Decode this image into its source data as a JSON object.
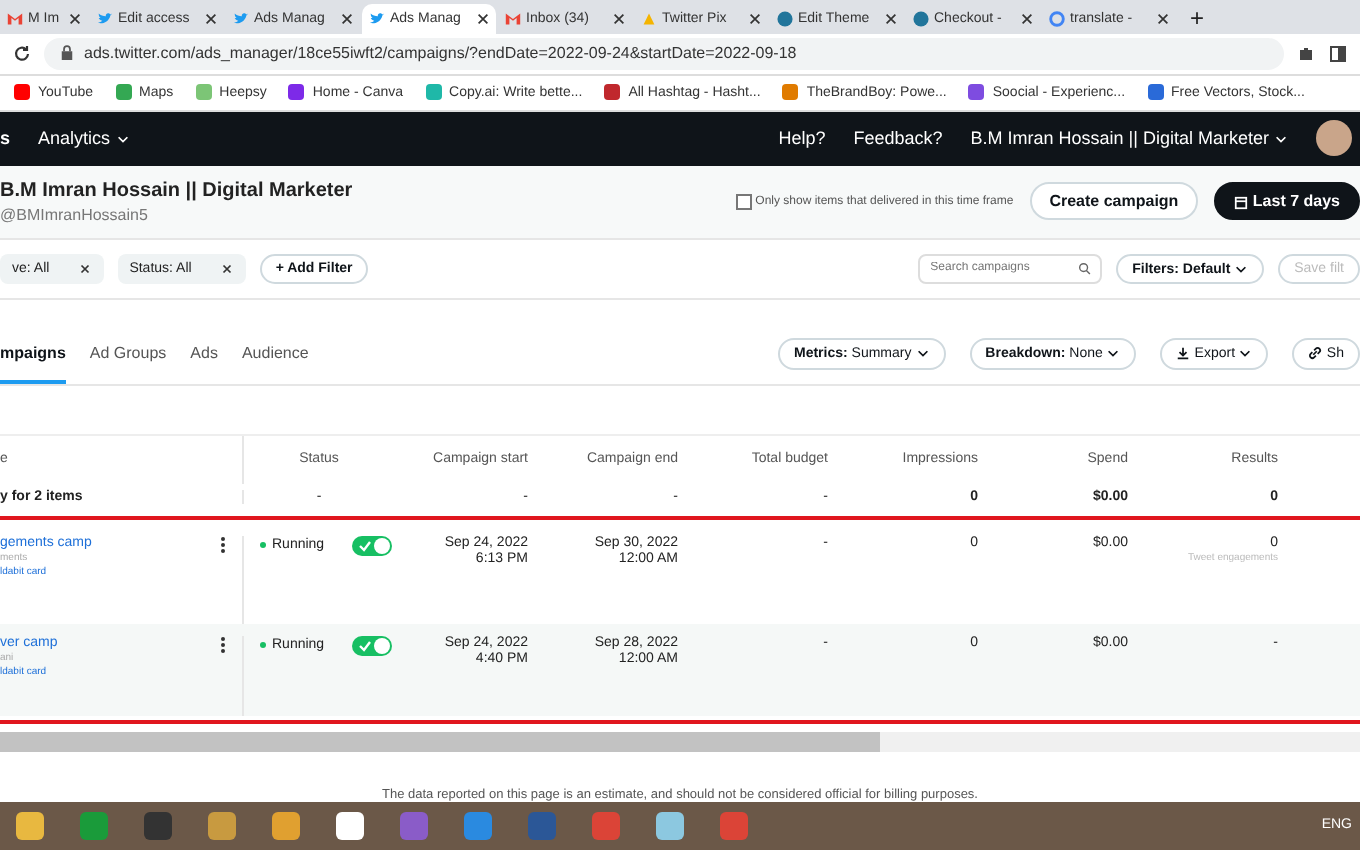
{
  "browser_tabs": [
    {
      "title": "M Im",
      "kind": "mail",
      "selected": false
    },
    {
      "title": "Edit access",
      "kind": "bird",
      "selected": false
    },
    {
      "title": "Ads Manag",
      "kind": "bird",
      "selected": false
    },
    {
      "title": "Ads Manag",
      "kind": "bird",
      "selected": true
    },
    {
      "title": "Inbox (34)",
      "kind": "mail",
      "selected": false
    },
    {
      "title": "Twitter Pix",
      "kind": "drive",
      "selected": false
    },
    {
      "title": "Edit Theme",
      "kind": "wp",
      "selected": false
    },
    {
      "title": "Checkout -",
      "kind": "wp",
      "selected": false
    },
    {
      "title": "translate -",
      "kind": "google",
      "selected": false
    }
  ],
  "new_tab": "+",
  "address": "ads.twitter.com/ads_manager/18ce55iwft2/campaigns/?endDate=2022-09-24&startDate=2022-09-18",
  "bookmarks": [
    {
      "label": "YouTube",
      "color": "#ff0000"
    },
    {
      "label": "Maps",
      "color": "#34a853"
    },
    {
      "label": "Heepsy",
      "color": "#7cc576"
    },
    {
      "label": "Home - Canva",
      "color": "#7d2ae8"
    },
    {
      "label": "Copy.ai: Write bette...",
      "color": "#1fb8a8"
    },
    {
      "label": "All Hashtag - Hasht...",
      "color": "#c0282d"
    },
    {
      "label": "TheBrandBoy: Powe...",
      "color": "#e07b00"
    },
    {
      "label": "Soocial - Experienc...",
      "color": "#7e4ce0"
    },
    {
      "label": "Free Vectors, Stock...",
      "color": "#2a6ad8"
    }
  ],
  "nav": {
    "logo": "s",
    "menu": "Analytics",
    "links": [
      "Help?",
      "Feedback?"
    ],
    "account": "B.M Imran Hossain || Digital Marketer"
  },
  "header": {
    "name": "B.M Imran Hossain || Digital Marketer",
    "handle": "@BMImranHossain5",
    "only_delivered": {
      "label": "Only show items that delivered in this time frame",
      "checked": false
    },
    "create": "Create campaign",
    "range": "Last 7 days"
  },
  "filters": [
    {
      "label": "ve: All"
    },
    {
      "label": "Status: All"
    }
  ],
  "add_filter": "+ Add Filter",
  "search": {
    "placeholder": "Search campaigns"
  },
  "filters_menu": "Filters: Default",
  "save_filter": "Save filt",
  "level_tabs": [
    {
      "label": "mpaigns",
      "selected": true
    },
    {
      "label": "Ad Groups",
      "selected": false
    },
    {
      "label": "Ads",
      "selected": false
    },
    {
      "label": "Audience",
      "selected": false
    }
  ],
  "toolbar": {
    "metrics": [
      "Metrics:",
      "Summary"
    ],
    "breakdown": [
      "Breakdown:",
      "None"
    ],
    "export": "Export",
    "share": "Sh"
  },
  "table": {
    "columns": [
      "e",
      "Status",
      "Campaign start",
      "Campaign end",
      "Total budget",
      "Impressions",
      "Spend",
      "Results"
    ],
    "summary": {
      "label": "y for 2 items",
      "cells": [
        "-",
        "-",
        "-",
        "-",
        "0",
        "$0.00",
        "0"
      ]
    },
    "rows": [
      {
        "name": "gements camp",
        "sub": "ments",
        "card": "ldabit card",
        "status": "Running",
        "on": true,
        "start": [
          "Sep 24, 2022",
          "6:13 PM"
        ],
        "end": [
          "Sep 30, 2022",
          "12:00 AM"
        ],
        "budget": "-",
        "impressions": "0",
        "spend": "$0.00",
        "results": "0",
        "results_sub": "Tweet engagements"
      },
      {
        "name": "ver camp",
        "sub": "ani",
        "card": "ldabit card",
        "status": "Running",
        "on": true,
        "start": [
          "Sep 24, 2022",
          "4:40 PM"
        ],
        "end": [
          "Sep 28, 2022",
          "12:00 AM"
        ],
        "budget": "-",
        "impressions": "0",
        "spend": "$0.00",
        "results": "-"
      }
    ]
  },
  "footer": "The data reported on this page is an estimate, and should not be considered official for billing purposes.",
  "taskbar": {
    "lang": "ENG"
  }
}
